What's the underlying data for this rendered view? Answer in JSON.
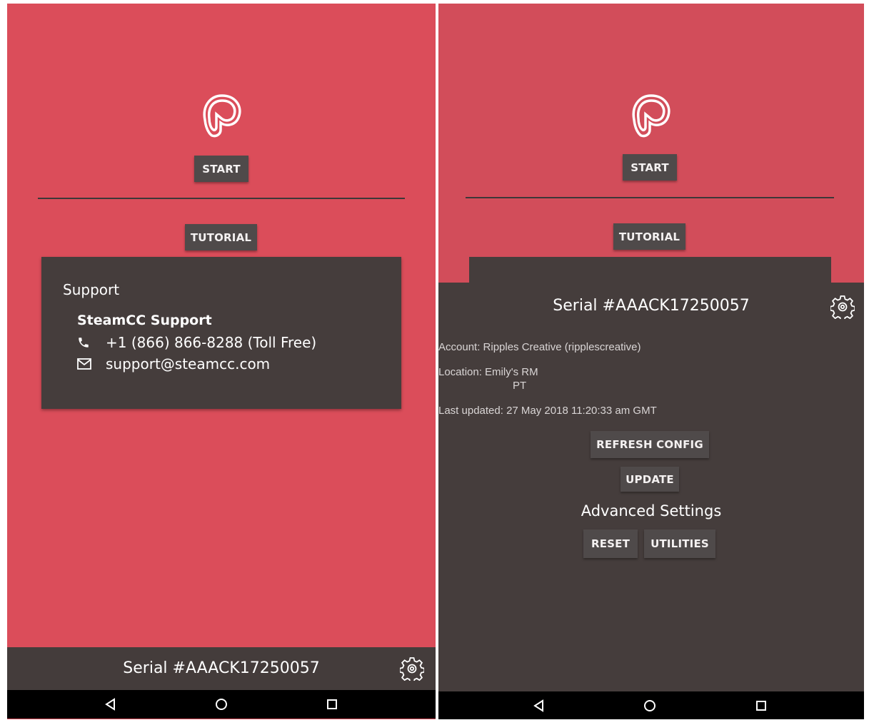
{
  "left_screen": {
    "logo_icon": "heart-outline-logo",
    "start_label": "START",
    "tutorial_label": "TUTORIAL",
    "support": {
      "title": "Support",
      "name": "SteamCC Support",
      "phone_icon": "phone-icon",
      "phone": "+1 (866) 866-8288 (Toll Free)",
      "email_icon": "mail-icon",
      "email": "support@steamcc.com"
    },
    "footer": {
      "serial": "Serial #AAACK17250057",
      "settings_icon": "gear-icon"
    }
  },
  "right_screen": {
    "logo_icon": "heart-outline-logo",
    "start_label": "START",
    "tutorial_label": "TUTORIAL",
    "panel": {
      "serial": "Serial #AAACK17250057",
      "settings_icon": "gear-icon",
      "account": "Account: Ripples Creative (ripplescreative)",
      "location_line1": "Location: Emily's RM",
      "location_line2": "PT",
      "last_updated": "Last updated: 27 May 2018 11:20:33 am GMT",
      "refresh_label": "REFRESH CONFIG",
      "update_label": "UPDATE",
      "advanced_label": "Advanced Settings",
      "reset_label": "RESET",
      "utilities_label": "UTILITIES"
    }
  },
  "nav": {
    "back_icon": "back-triangle-icon",
    "home_icon": "home-circle-icon",
    "recents_icon": "recents-square-icon"
  },
  "colors": {
    "brand_red": "#db4d5a",
    "panel_dark": "#453d3c",
    "button_gray": "#4f4a4a"
  }
}
